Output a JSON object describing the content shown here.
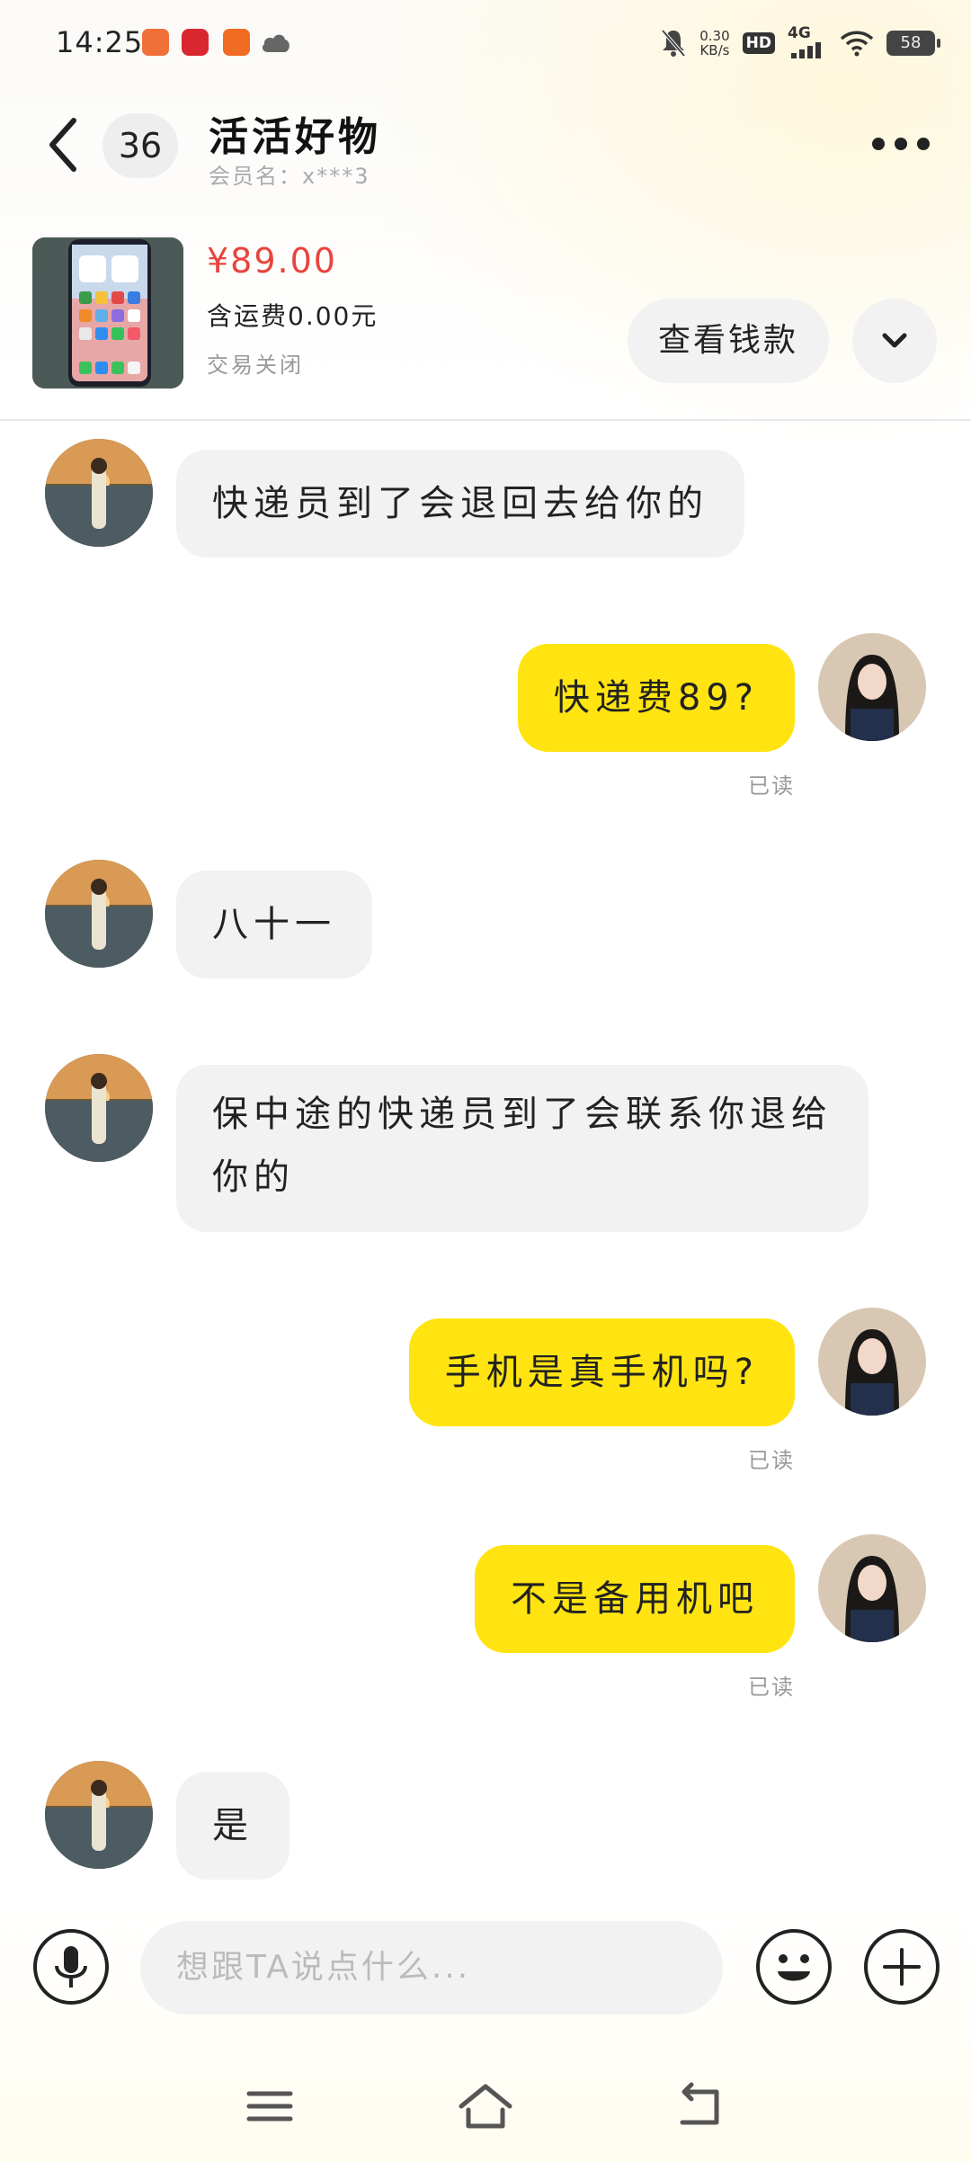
{
  "status_bar": {
    "time": "14:25",
    "network_speed": "0.30",
    "network_speed_unit": "KB/s",
    "hd_label": "HD",
    "signal_label": "4G",
    "battery": "58"
  },
  "header": {
    "unread_count": "36",
    "shop_name": "活活好物",
    "member_label": "会员名：x***3"
  },
  "product": {
    "price": "¥89.00",
    "shipping": "含运费0.00元",
    "status": "交易关闭",
    "view_button": "查看钱款"
  },
  "messages": [
    {
      "side": "left",
      "text": "快递员到了会退回去给你的"
    },
    {
      "side": "right",
      "text": "快递费89?",
      "read": "已读"
    },
    {
      "side": "left",
      "text": "八十一"
    },
    {
      "side": "left",
      "text": "保中途的快递员到了会联系你退给你的"
    },
    {
      "side": "right",
      "text": "手机是真手机吗?",
      "read": "已读"
    },
    {
      "side": "right",
      "text": "不是备用机吧",
      "read": "已读"
    },
    {
      "side": "left",
      "text": "是"
    }
  ],
  "input": {
    "placeholder": "想跟TA说点什么..."
  },
  "icons": {
    "back": "chevron-left-icon",
    "more": "more-dots-icon",
    "expand": "chevron-down-icon",
    "voice": "microphone-icon",
    "emoji": "smiley-icon",
    "add": "plus-icon",
    "menu": "menu-icon",
    "home": "home-icon",
    "return": "back-icon"
  },
  "colors": {
    "accent_yellow": "#ffe411",
    "price_red": "#e8443c",
    "bubble_gray": "#f2f2f3"
  }
}
